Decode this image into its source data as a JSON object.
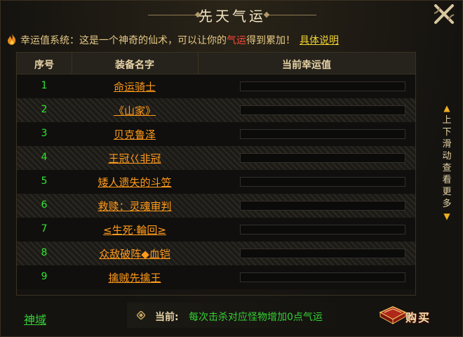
{
  "window": {
    "title": "先天气运"
  },
  "info": {
    "prefix": "幸运值系统：这是一个神奇的仙术，可以让你的",
    "highlight": "气运",
    "suffix": "得到累加！",
    "link_label": "具体说明"
  },
  "table": {
    "headers": [
      "序号",
      "装备名字",
      "当前幸运值"
    ],
    "rows": [
      {
        "index": "1",
        "name": "命运骑士"
      },
      {
        "index": "2",
        "name": "《山家》"
      },
      {
        "index": "3",
        "name": "贝克鲁泽"
      },
      {
        "index": "4",
        "name": "王冠巜非冠"
      },
      {
        "index": "5",
        "name": "矮人遗失的斗笠"
      },
      {
        "index": "6",
        "name": "救赎：灵魂审判"
      },
      {
        "index": "7",
        "name": "≤生死·輪回≥"
      },
      {
        "index": "8",
        "name": "众敌破阵◆血铠"
      },
      {
        "index": "9",
        "name": "擒贼先擒王"
      }
    ]
  },
  "scroll_hint": {
    "text": "上下滑动查看更多"
  },
  "footer": {
    "realm_link": "神域",
    "status_label": "当前:",
    "status_text": "每次击杀对应怪物增加0点气运",
    "buy_label": "购买"
  },
  "colors": {
    "index_green": "#2fe62f",
    "name_orange": "#ff9a1a",
    "link_yellow": "#f0d230",
    "highlight_red": "#ff4a3a"
  }
}
